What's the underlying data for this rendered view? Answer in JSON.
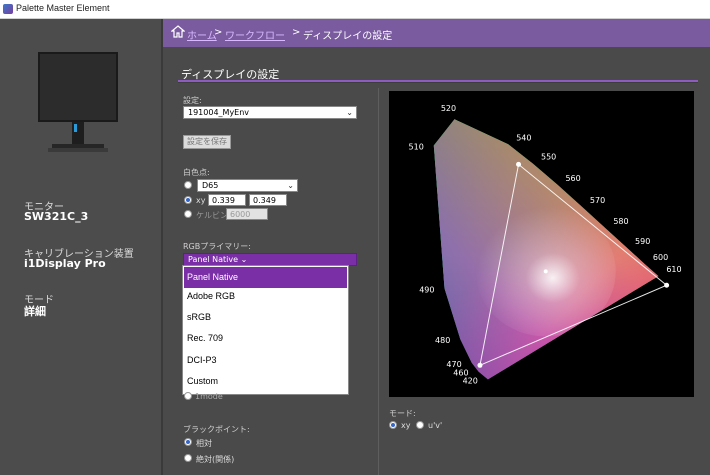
{
  "window": {
    "title": "Palette Master Element"
  },
  "left_panel": {
    "monitor_label": "モニター",
    "monitor_value": "SW321C_3",
    "calibrator_label": "キャリブレーション装置",
    "calibrator_value": "i1Display Pro",
    "mode_label": "モード",
    "mode_value": "詳細"
  },
  "breadcrumb": {
    "home": "ホーム",
    "sep1": ">",
    "workflow": "ワークフロー",
    "sep2": ">",
    "current": "ディスプレイの設定"
  },
  "page": {
    "title": "ディスプレイの設定"
  },
  "settings": {
    "preset_label": "設定:",
    "preset_value": "191004_MyEnv",
    "save_button": "設定を保存",
    "whitepoint_label": "白色点:",
    "whitepoint_preset": "D65",
    "xy_label": "xy",
    "x_value": "0.339",
    "y_value": "0.349",
    "kelvin_label": "ケルビン",
    "kelvin_value": "6000",
    "rgb_primary_label": "RGBプライマリー:",
    "rgb_primary_value": "Panel Native",
    "rgb_options": [
      "Panel Native",
      "Adobe RGB",
      "sRGB",
      "Rec. 709",
      "DCI-P3",
      "Custom"
    ],
    "below_list_partial": "1mode",
    "gamma_label": "ブラックポイント:",
    "gamma_opt1": "相対",
    "gamma_opt2": "絶対(関係)"
  },
  "chart_panel": {
    "mode_label": "モード:",
    "mode_xy": "xy",
    "mode_uv": "u'v'"
  },
  "chart_data": {
    "type": "scatter",
    "wavelength_labels": [
      {
        "nm": "520",
        "x": 0.074,
        "y": 0.834
      },
      {
        "nm": "540",
        "x": 0.23,
        "y": 0.754
      },
      {
        "nm": "550",
        "x": 0.302,
        "y": 0.692
      },
      {
        "nm": "560",
        "x": 0.373,
        "y": 0.625
      },
      {
        "nm": "570",
        "x": 0.444,
        "y": 0.555
      },
      {
        "nm": "580",
        "x": 0.512,
        "y": 0.487
      },
      {
        "nm": "590",
        "x": 0.575,
        "y": 0.424
      },
      {
        "nm": "600",
        "x": 0.627,
        "y": 0.372
      },
      {
        "nm": "610",
        "x": 0.666,
        "y": 0.334
      },
      {
        "nm": "510",
        "x": 0.014,
        "y": 0.75
      },
      {
        "nm": "490",
        "x": 0.045,
        "y": 0.295
      },
      {
        "nm": "480",
        "x": 0.091,
        "y": 0.133
      },
      {
        "nm": "470",
        "x": 0.124,
        "y": 0.058
      },
      {
        "nm": "460",
        "x": 0.144,
        "y": 0.03
      },
      {
        "nm": "420",
        "x": 0.171,
        "y": 0.005
      }
    ],
    "gamut_triangle": [
      {
        "name": "R",
        "x": 0.69,
        "y": 0.305
      },
      {
        "name": "G",
        "x": 0.26,
        "y": 0.69
      },
      {
        "name": "B",
        "x": 0.148,
        "y": 0.05
      }
    ],
    "white_point": {
      "x": 0.339,
      "y": 0.349
    },
    "colors": {
      "triangle": "#ffffff",
      "background": "#000000"
    }
  },
  "colors": {
    "accent": "#7a5ba0",
    "selection": "#7a2fa6",
    "panel": "#4a4a4a"
  }
}
